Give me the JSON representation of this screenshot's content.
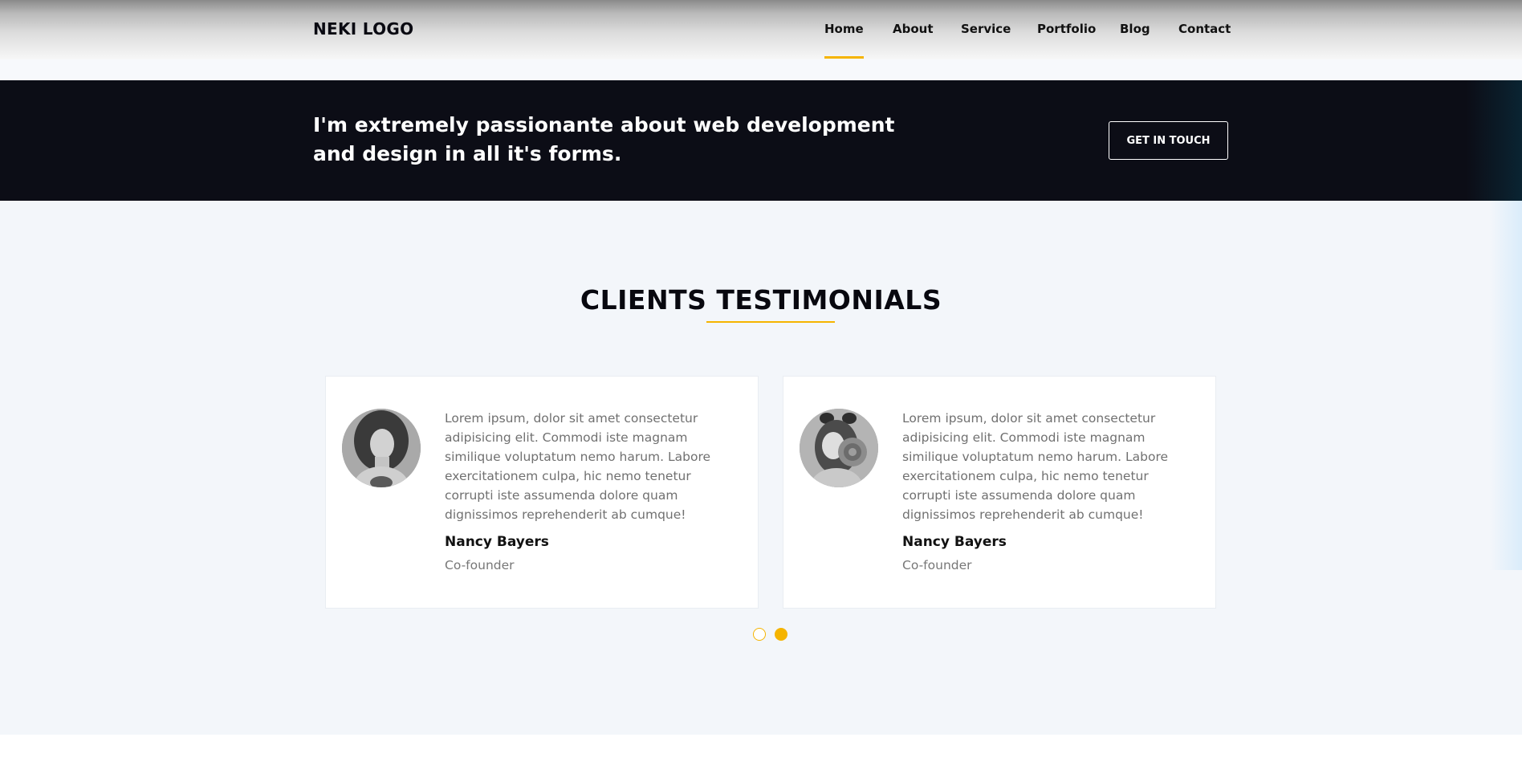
{
  "header": {
    "logo": "NEKI LOGO",
    "nav": [
      {
        "label": "Home",
        "active": true
      },
      {
        "label": "About"
      },
      {
        "label": "Service"
      },
      {
        "label": "Portfolio"
      },
      {
        "label": "Blog"
      },
      {
        "label": "Contact"
      }
    ]
  },
  "banner": {
    "text": "I'm extremely passionante about web development and design in all it's forms.",
    "button_label": "GET IN TOUCH"
  },
  "testimonials": {
    "title": "CLIENTS TESTIMONIALS",
    "items": [
      {
        "quote": "Lorem ipsum, dolor sit amet consectetur adipisicing elit. Commodi iste magnam similique voluptatum nemo harum. Labore exercitationem culpa, hic nemo tenetur corrupti iste assumenda dolore quam dignissimos reprehenderit ab cumque!",
        "name": "Nancy Bayers",
        "role": "Co-founder"
      },
      {
        "quote": "Lorem ipsum, dolor sit amet consectetur adipisicing elit. Commodi iste magnam similique voluptatum nemo harum. Labore exercitationem culpa, hic nemo tenetur corrupti iste assumenda dolore quam dignissimos reprehenderit ab cumque!",
        "name": "Nancy Bayers",
        "role": "Co-founder"
      }
    ],
    "carousel": {
      "active_index": 1,
      "count": 2
    }
  },
  "colors": {
    "accent": "#f5b400",
    "banner_bg": "#0c0d16",
    "section_bg": "#f3f6fa"
  }
}
